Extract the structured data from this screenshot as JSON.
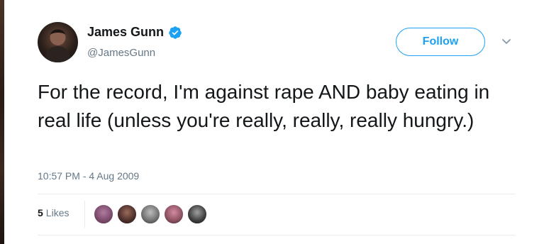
{
  "author": {
    "display_name": "James Gunn",
    "handle": "@JamesGunn",
    "verified_icon": "verified-badge-icon",
    "avatar_icon": "profile-photo-avatar"
  },
  "actions": {
    "follow_label": "Follow",
    "menu_icon": "chevron-down-icon"
  },
  "tweet": {
    "text": "For the record, I'm against rape AND baby eating in real life (unless you're really, really, really hungry.)",
    "timestamp": "10:57 PM - 4 Aug 2009"
  },
  "engagement": {
    "likes_count": "5",
    "likes_label": "Likes",
    "liker_avatars": [
      {
        "color": "#7a4a6a"
      },
      {
        "color": "#4a2e2a"
      },
      {
        "color": "#6f6f6f"
      },
      {
        "color": "#8a5060"
      },
      {
        "color": "#3c3c3c"
      }
    ]
  },
  "colors": {
    "accent": "#1da1f2",
    "text_primary": "#14171a",
    "text_secondary": "#657786",
    "divider": "#e6ecf0"
  }
}
